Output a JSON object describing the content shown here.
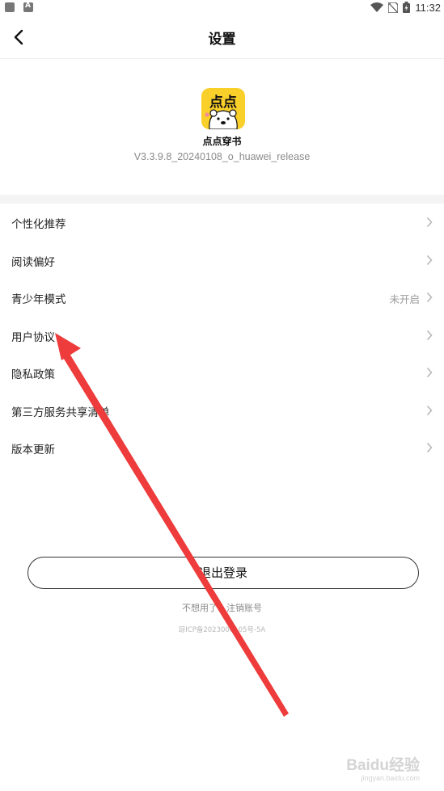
{
  "status_bar": {
    "time": "11:32"
  },
  "header": {
    "title": "设置"
  },
  "app_info": {
    "logo_text": "点点",
    "name": "点点穿书",
    "version": "V3.3.9.8_20240108_o_huawei_release"
  },
  "menu": {
    "items": [
      {
        "label": "个性化推荐",
        "value": ""
      },
      {
        "label": "阅读偏好",
        "value": ""
      },
      {
        "label": "青少年模式",
        "value": "未开启"
      },
      {
        "label": "用户协议",
        "value": ""
      },
      {
        "label": "隐私政策",
        "value": ""
      },
      {
        "label": "第三方服务共享清单",
        "value": ""
      },
      {
        "label": "版本更新",
        "value": ""
      }
    ]
  },
  "footer": {
    "logout_label": "退出登录",
    "cancel_account_label": "不想用了？注销账号",
    "icp_text": "琼ICP备2023000105号-5A"
  },
  "watermark": {
    "brand": "Baidu经验",
    "url": "jingyan.baidu.com"
  },
  "colors": {
    "logo_yellow": "#f9cf2a",
    "annotation_arrow": "#ee3b3b"
  }
}
